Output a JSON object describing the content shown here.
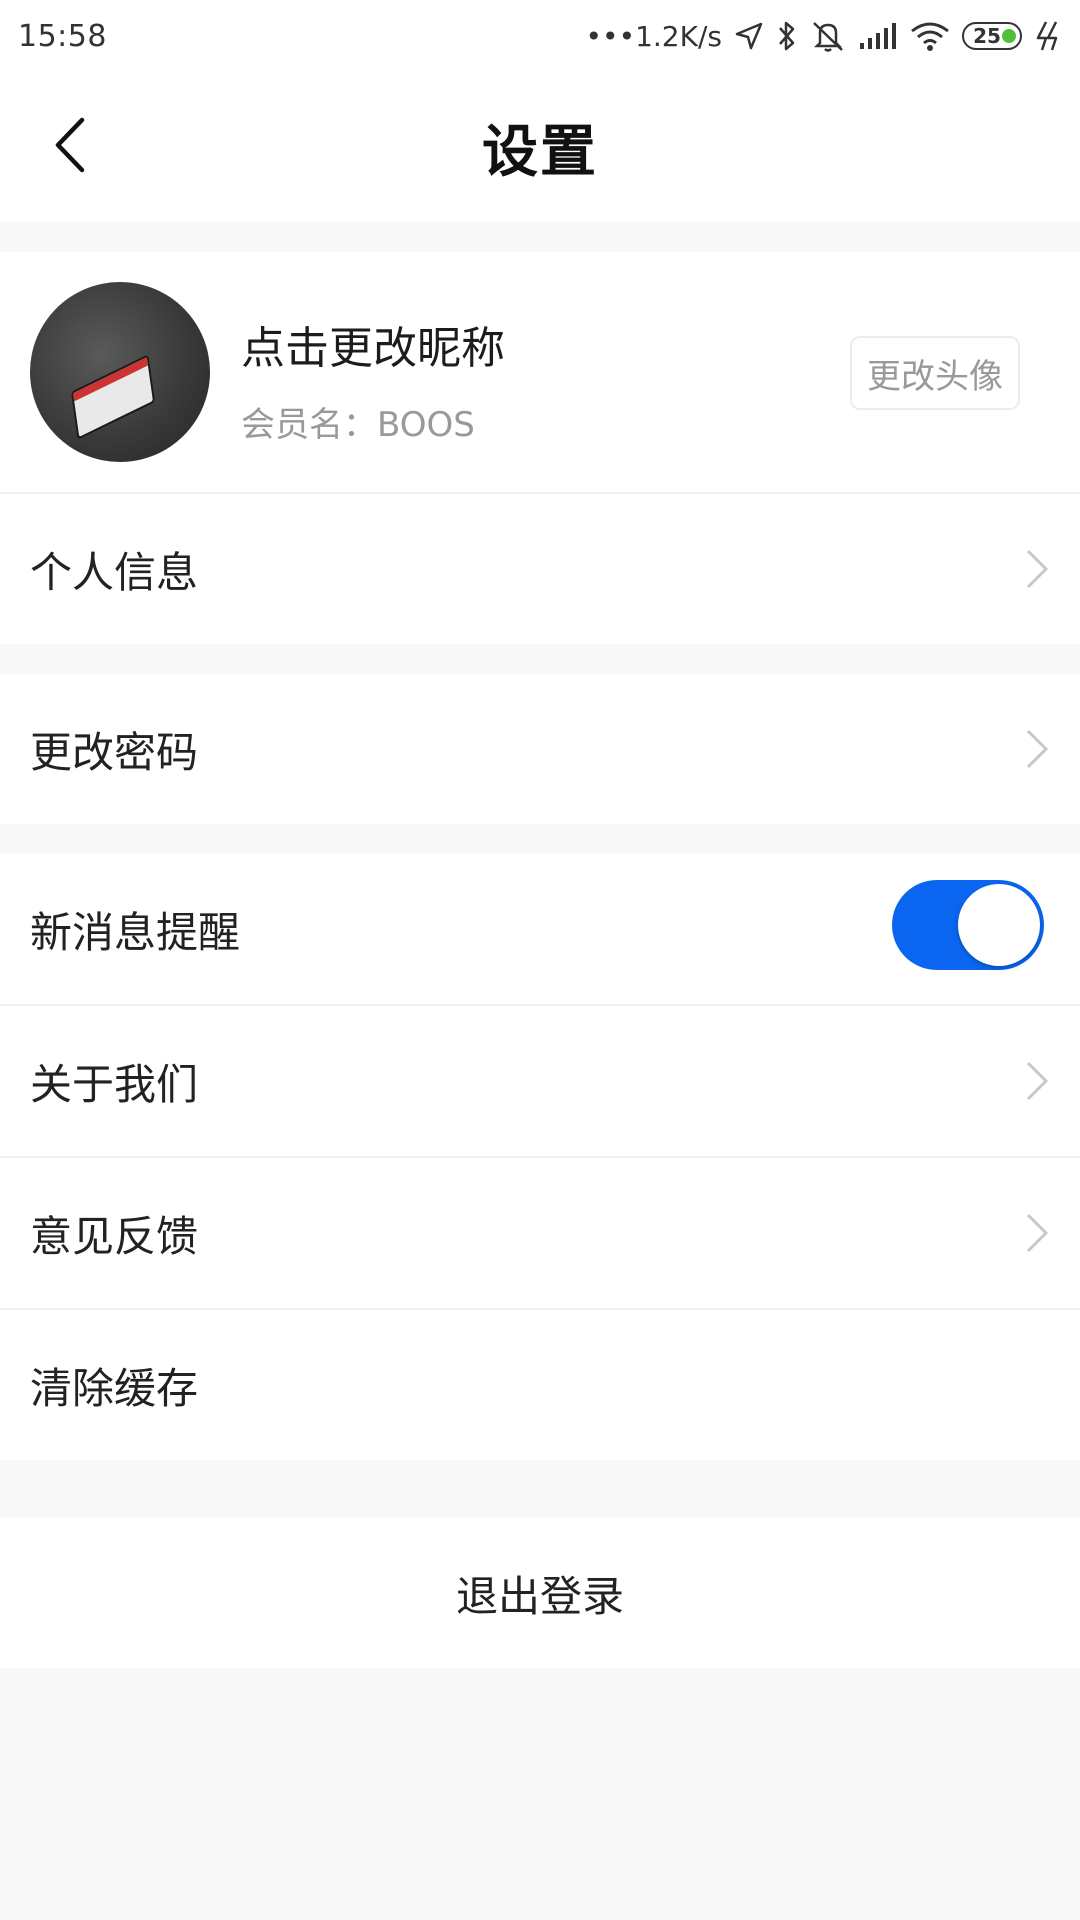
{
  "status_bar": {
    "time": "15:58",
    "net_speed": "•••1.2K/s",
    "battery_level": "25",
    "icons": [
      "location-icon",
      "bluetooth-icon",
      "mute-icon",
      "signal-icon",
      "wifi-icon",
      "battery-icon",
      "charging-icon"
    ]
  },
  "header": {
    "title": "设置",
    "back_icon": "chevron-left-icon"
  },
  "profile": {
    "nickname": "点击更改昵称",
    "member_name": "会员名：BOOS",
    "change_avatar_label": "更改头像"
  },
  "menu": {
    "personal_info": "个人信息",
    "change_password": "更改密码",
    "new_message_alert": "新消息提醒",
    "new_message_alert_on": true,
    "about_us": "关于我们",
    "feedback": "意见反馈",
    "clear_cache": "清除缓存"
  },
  "logout_label": "退出登录",
  "colors": {
    "accent": "#0a66f0",
    "background": "#f8f8f8",
    "battery_dot": "#4cc038"
  }
}
